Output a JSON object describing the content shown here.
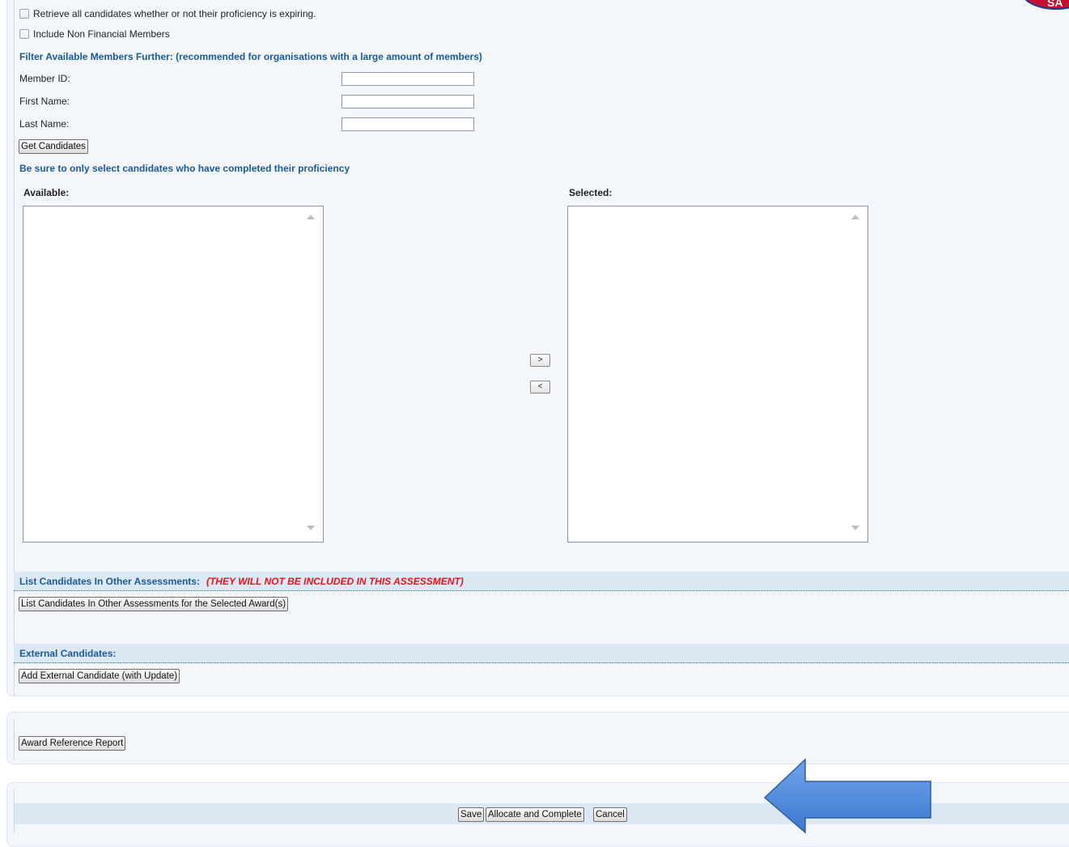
{
  "options": {
    "retrieve_all_label": "Retrieve all candidates whether or not their proficiency is expiring.",
    "include_non_financial_label": "Include Non Financial Members"
  },
  "filter": {
    "heading": "Filter Available Members Further: (recommended for organisations with a large amount of members)",
    "member_id_label": "Member ID:",
    "member_id_value": "",
    "first_name_label": "First Name:",
    "first_name_value": "",
    "last_name_label": "Last Name:",
    "last_name_value": "",
    "get_candidates_label": "Get Candidates"
  },
  "selection": {
    "note": "Be sure to only select candidates who have completed their proficiency",
    "available_label": "Available:",
    "selected_label": "Selected:",
    "move_right_label": ">",
    "move_left_label": "<"
  },
  "other_assessments": {
    "heading": "List Candidates In Other Assessments:",
    "warning": "(THEY WILL NOT BE INCLUDED IN THIS ASSESSMENT)",
    "button_label": "List Candidates In Other Assessments for the Selected Award(s)"
  },
  "external": {
    "heading": "External Candidates:",
    "button_label": "Add External Candidate (with Update)"
  },
  "report": {
    "button_label": "Award Reference Report"
  },
  "actions": {
    "save_label": "Save",
    "allocate_label": "Allocate and Complete",
    "cancel_label": "Cancel"
  },
  "logo": {
    "text": "SA"
  },
  "colors": {
    "heading_blue": "#1a5a9c",
    "warning_red": "#e8141e",
    "panel_bg": "#f3f7fb",
    "section_bar_bg": "#dce8f3",
    "callout_arrow": "#4a86d8"
  }
}
